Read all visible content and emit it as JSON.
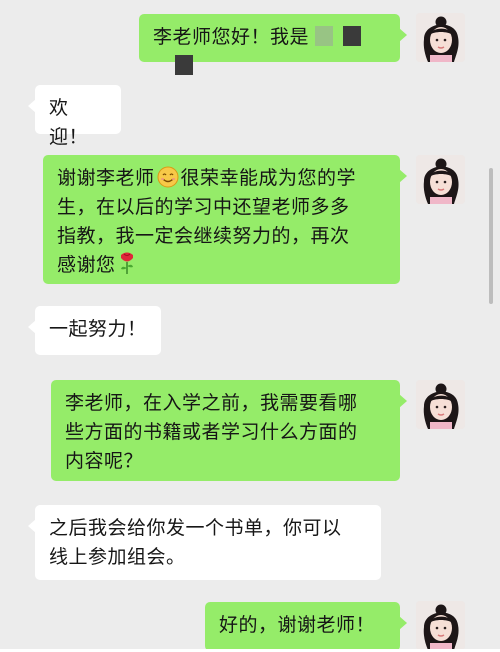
{
  "messages": [
    {
      "side": "me",
      "text": "李老师您好！我是"
    },
    {
      "side": "them",
      "text": "欢迎！"
    },
    {
      "side": "me",
      "lines": [
        "谢谢李老师",
        "很荣幸能成为您的学",
        "生，在以后的学习中还望老师多多",
        "指教，我一定会继续努力的，再次",
        "感谢您"
      ],
      "emojis": [
        "smile-emoji",
        "rose-emoji"
      ]
    },
    {
      "side": "them",
      "text": "一起努力！"
    },
    {
      "side": "me",
      "lines": [
        "李老师，在入学之前，我需要看哪",
        "些方面的书籍或者学习什么方面的",
        "内容呢？"
      ]
    },
    {
      "side": "them",
      "lines": [
        "之后我会给你发一个书单，你可以",
        "线上参加组会。"
      ]
    },
    {
      "side": "me",
      "text": "好的，谢谢老师！"
    }
  ],
  "colors": {
    "background": "#ececec",
    "outgoing_bubble": "#95ec69",
    "incoming_bubble": "#ffffff"
  }
}
